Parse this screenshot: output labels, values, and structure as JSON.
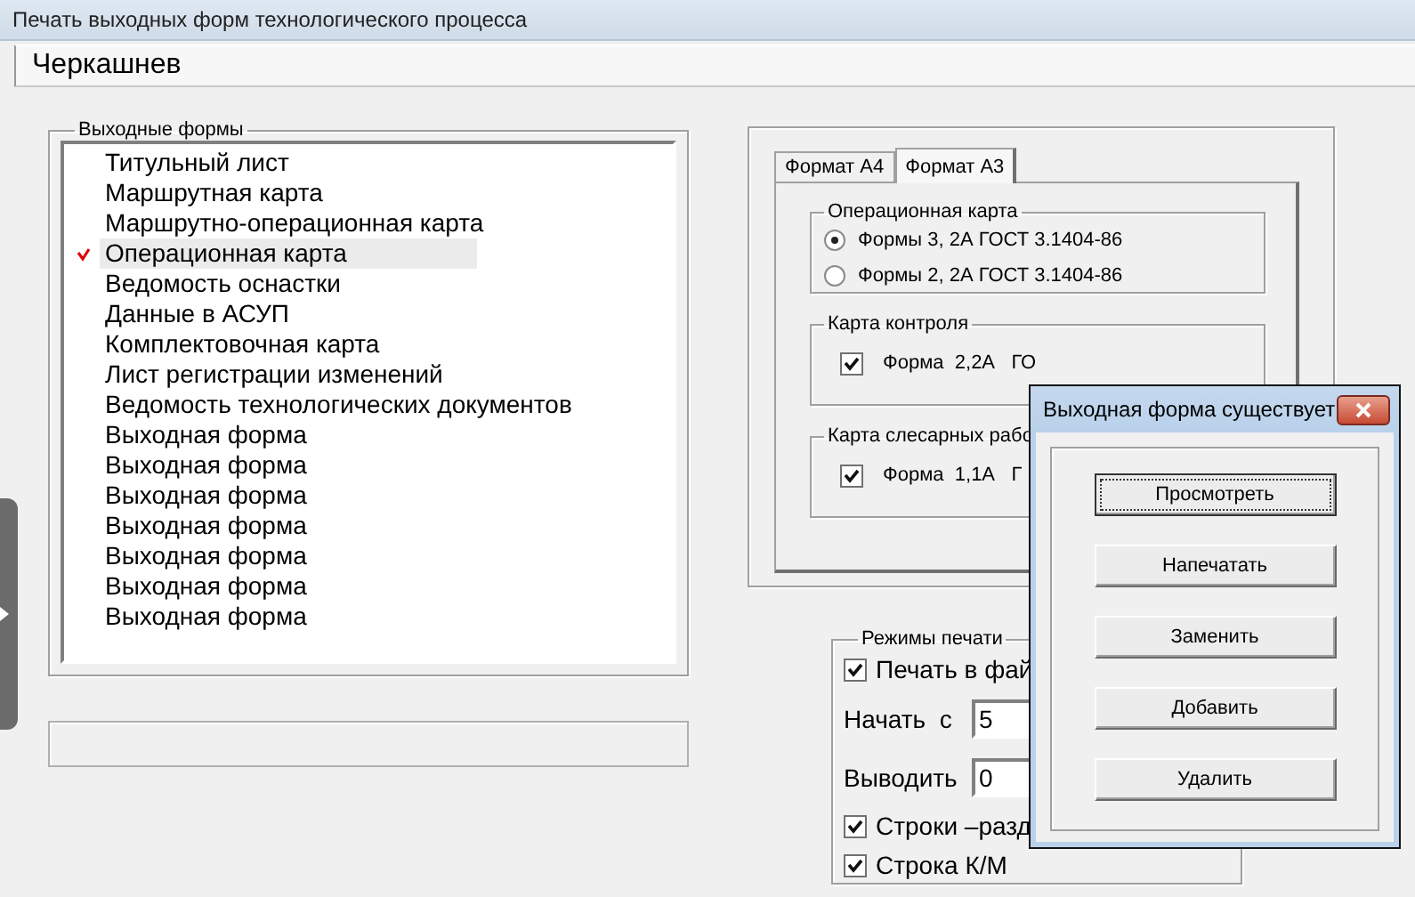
{
  "window": {
    "title": "Печать выходных форм технологического процесса"
  },
  "header": {
    "user": "Черкашнев"
  },
  "output_forms": {
    "title": "Выходные формы",
    "items": [
      {
        "label": "Титульный лист",
        "selected": false,
        "checked": false
      },
      {
        "label": "Маршрутная карта",
        "selected": false,
        "checked": false
      },
      {
        "label": "Маршрутно-операционная карта",
        "selected": false,
        "checked": false
      },
      {
        "label": "Операционная карта",
        "selected": true,
        "checked": true
      },
      {
        "label": "Ведомость оснастки",
        "selected": false,
        "checked": false
      },
      {
        "label": "Данные в АСУП",
        "selected": false,
        "checked": false
      },
      {
        "label": "Комплектовочная карта",
        "selected": false,
        "checked": false
      },
      {
        "label": "Лист регистрации изменений",
        "selected": false,
        "checked": false
      },
      {
        "label": "Ведомость технологических документов",
        "selected": false,
        "checked": false
      },
      {
        "label": "Выходная форма",
        "selected": false,
        "checked": false
      },
      {
        "label": "Выходная форма",
        "selected": false,
        "checked": false
      },
      {
        "label": "Выходная форма",
        "selected": false,
        "checked": false
      },
      {
        "label": "Выходная форма",
        "selected": false,
        "checked": false
      },
      {
        "label": "Выходная форма",
        "selected": false,
        "checked": false
      },
      {
        "label": "Выходная форма",
        "selected": false,
        "checked": false
      },
      {
        "label": "Выходная форма",
        "selected": false,
        "checked": false
      }
    ]
  },
  "format_tabs": [
    {
      "label": "Формат А4",
      "selected": false
    },
    {
      "label": "Формат А3",
      "selected": true
    }
  ],
  "tab_groups": [
    {
      "title": "Операционная карта",
      "options": [
        {
          "kind": "radio",
          "label": "Формы 3, 2А ГОСТ 3.1404-86",
          "checked": true
        },
        {
          "kind": "radio",
          "label": "Формы 2, 2А ГОСТ 3.1404-86",
          "checked": false
        }
      ]
    },
    {
      "title": "Карта контроля",
      "options": [
        {
          "kind": "checkbox",
          "label": "Форма  2,2А   ГО",
          "checked": true
        }
      ]
    },
    {
      "title": "Карта слесарных рабо",
      "options": [
        {
          "kind": "checkbox",
          "label": "Форма  1,1А   Г",
          "checked": true
        }
      ]
    }
  ],
  "print_modes": {
    "title": "Режимы печати",
    "rows": [
      {
        "kind": "checkbox",
        "label": "Печать в фай",
        "checked": true
      },
      {
        "kind": "spin",
        "label": "Начать  с",
        "value": "5"
      },
      {
        "kind": "spin",
        "label": "Выводить",
        "value": "0"
      },
      {
        "kind": "checkbox",
        "label": "Строки –разд",
        "checked": true
      },
      {
        "kind": "checkbox",
        "label": "Строка К/М",
        "checked": true
      }
    ]
  },
  "dialog": {
    "title": "Выходная форма существует",
    "buttons": [
      {
        "label": "Просмотреть",
        "focused": true
      },
      {
        "label": "Напечатать",
        "focused": false
      },
      {
        "label": "Заменить",
        "focused": false
      },
      {
        "label": "Добавить",
        "focused": false
      },
      {
        "label": "Удалить",
        "focused": false
      }
    ]
  }
}
